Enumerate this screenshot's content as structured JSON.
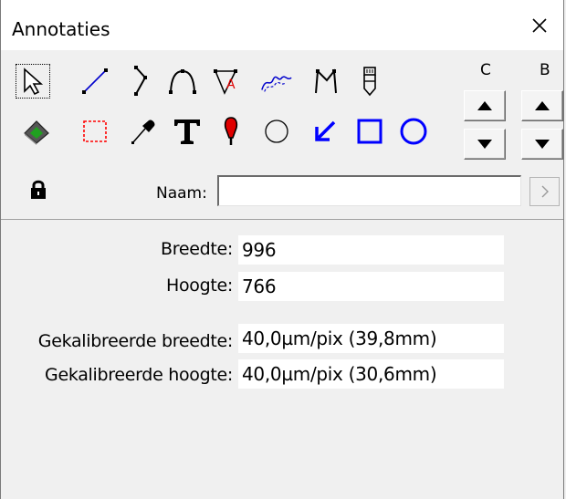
{
  "window": {
    "title": "Annotaties",
    "close_icon": "close-icon"
  },
  "toolbar": {
    "row1_tools": [
      "pointer-icon",
      "line-icon",
      "polyline-icon",
      "arc-icon",
      "polygon-text-icon",
      "freehand-icon",
      "measure-angle-icon",
      "pencil-icon"
    ],
    "row2_tools": [
      "fill-eraser-icon",
      "dashed-rectangle-icon",
      "eyedropper-icon",
      "text-icon",
      "marker-pin-icon",
      "circle-outline-icon",
      "arrow-icon",
      "rectangle-icon",
      "ellipse-icon"
    ],
    "column_c_label": "C",
    "column_b_label": "B",
    "lock_icon": "lock-icon",
    "name_label": "Naam:",
    "name_value": "",
    "go_icon": "chevron-right-icon"
  },
  "info": {
    "width_label": "Breedte:",
    "width_value": "996",
    "height_label": "Hoogte:",
    "height_value": "766",
    "cal_width_label": "Gekalibreerde breedte:",
    "cal_width_value": "40,0µm/pix (39,8mm)",
    "cal_height_label": "Gekalibreerde hoogte:",
    "cal_height_value": "40,0µm/pix (30,6mm)"
  },
  "colors": {
    "accent_blue": "#0000ff",
    "marker_red": "#e00000",
    "dashed_red": "#ff0000"
  }
}
